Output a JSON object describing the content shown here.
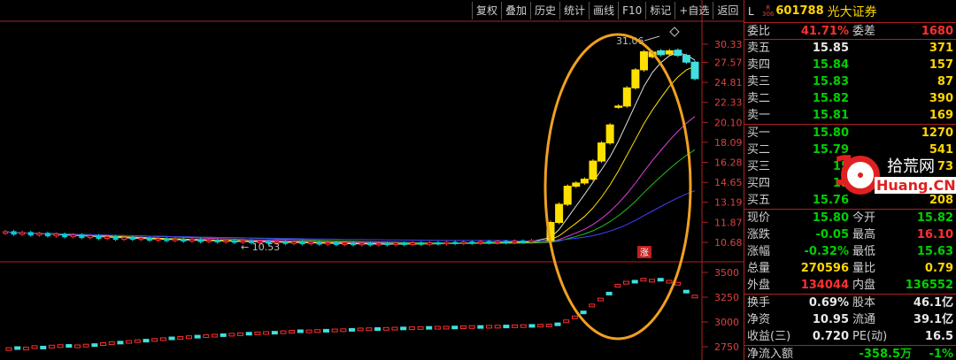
{
  "toolbar": {
    "buttons": [
      "复权",
      "叠加",
      "历史",
      "统计",
      "画线",
      "F10",
      "标记",
      "+自选",
      "返回"
    ]
  },
  "quote": {
    "market": "L",
    "market_sub": [
      "R",
      "306"
    ],
    "code": "601788",
    "name": "光大证券",
    "weibi_label": "委比",
    "weibi_value": "41.71%",
    "weicha_label": "委差",
    "weicha_value": "1680",
    "asks": [
      {
        "label": "卖五",
        "price": "15.85",
        "vol": "371"
      },
      {
        "label": "卖四",
        "price": "15.84",
        "vol": "157"
      },
      {
        "label": "卖三",
        "price": "15.83",
        "vol": "87"
      },
      {
        "label": "卖二",
        "price": "15.82",
        "vol": "390"
      },
      {
        "label": "卖一",
        "price": "15.81",
        "vol": "169"
      }
    ],
    "bids": [
      {
        "label": "买一",
        "price": "15.80",
        "vol": "1270"
      },
      {
        "label": "买二",
        "price": "15.79",
        "vol": "541"
      },
      {
        "label": "买三",
        "price": "15",
        "vol": "73"
      },
      {
        "label": "买四",
        "price": "15",
        "vol": "2"
      },
      {
        "label": "买五",
        "price": "15.76",
        "vol": "208"
      }
    ],
    "stats": [
      {
        "l1": "现价",
        "v1": "15.80",
        "c1": "green",
        "l2": "今开",
        "v2": "15.82",
        "c2": "green"
      },
      {
        "l1": "涨跌",
        "v1": "-0.05",
        "c1": "green",
        "l2": "最高",
        "v2": "16.10",
        "c2": "red"
      },
      {
        "l1": "涨幅",
        "v1": "-0.32%",
        "c1": "green",
        "l2": "最低",
        "v2": "15.63",
        "c2": "green"
      },
      {
        "l1": "总量",
        "v1": "270596",
        "c1": "yellow",
        "l2": "量比",
        "v2": "0.79",
        "c2": "yellow"
      },
      {
        "l1": "外盘",
        "v1": "134044",
        "c1": "red",
        "l2": "内盘",
        "v2": "136552",
        "c2": "green"
      }
    ],
    "fund": [
      {
        "l1": "换手",
        "v1": "0.69%",
        "l2": "股本",
        "v2": "46.1亿"
      },
      {
        "l1": "净资",
        "v1": "10.95",
        "l2": "流通",
        "v2": "39.1亿"
      },
      {
        "l1": "收益(三)",
        "v1": "0.720",
        "l2": "PE(动)",
        "v2": "16.5"
      }
    ],
    "netflow_label": "净流入额",
    "netflow_value": "-358.5万",
    "netflow_pct": "-1%"
  },
  "watermark": {
    "cn": "拾荒网",
    "en": "Huang.CN",
    "digit": "1"
  },
  "colors": {
    "up": "#ff3030",
    "down": "#00d0d0",
    "highlight": "#ffd700",
    "ring": "#f0a020"
  },
  "chart_data": {
    "type": "candlestick",
    "price_axis": [
      "30.33",
      "27.57",
      "24.81",
      "22.33",
      "20.10",
      "18.09",
      "16.28",
      "14.65",
      "13.19",
      "11.87",
      "10.68"
    ],
    "volume_axis": [
      "3500",
      "3250",
      "3000",
      "2750"
    ],
    "annotations": {
      "high": "31.06",
      "low": "10.53",
      "mark": "涨"
    },
    "candles": [
      {
        "o": 11.2,
        "c": 11.3
      },
      {
        "o": 11.3,
        "c": 11.15
      },
      {
        "o": 11.15,
        "c": 11.25
      },
      {
        "o": 11.25,
        "c": 11.1
      },
      {
        "o": 11.1,
        "c": 11.2
      },
      {
        "o": 11.2,
        "c": 11.05
      },
      {
        "o": 11.05,
        "c": 11.15
      },
      {
        "o": 11.15,
        "c": 11.0
      },
      {
        "o": 11.0,
        "c": 11.1
      },
      {
        "o": 11.1,
        "c": 10.95
      },
      {
        "o": 10.95,
        "c": 11.05
      },
      {
        "o": 11.05,
        "c": 10.9
      },
      {
        "o": 10.9,
        "c": 11.0
      },
      {
        "o": 11.0,
        "c": 10.85
      },
      {
        "o": 10.85,
        "c": 10.95
      },
      {
        "o": 10.95,
        "c": 10.85
      },
      {
        "o": 10.85,
        "c": 10.92
      },
      {
        "o": 10.92,
        "c": 10.8
      },
      {
        "o": 10.8,
        "c": 10.88
      },
      {
        "o": 10.88,
        "c": 10.78
      },
      {
        "o": 10.78,
        "c": 10.86
      },
      {
        "o": 10.86,
        "c": 10.75
      },
      {
        "o": 10.75,
        "c": 10.84
      },
      {
        "o": 10.84,
        "c": 10.72
      },
      {
        "o": 10.72,
        "c": 10.8
      },
      {
        "o": 10.8,
        "c": 10.7
      },
      {
        "o": 10.7,
        "c": 10.78
      },
      {
        "o": 10.78,
        "c": 10.68
      },
      {
        "o": 10.68,
        "c": 10.76
      },
      {
        "o": 10.76,
        "c": 10.66
      },
      {
        "o": 10.66,
        "c": 10.74
      },
      {
        "o": 10.74,
        "c": 10.64
      },
      {
        "o": 10.64,
        "c": 10.72
      },
      {
        "o": 10.72,
        "c": 10.62
      },
      {
        "o": 10.62,
        "c": 10.7
      },
      {
        "o": 10.7,
        "c": 10.6
      },
      {
        "o": 10.6,
        "c": 10.68
      },
      {
        "o": 10.68,
        "c": 10.58
      },
      {
        "o": 10.58,
        "c": 10.66
      },
      {
        "o": 10.66,
        "c": 10.56
      },
      {
        "o": 10.56,
        "c": 10.64
      },
      {
        "o": 10.64,
        "c": 10.55
      },
      {
        "o": 10.55,
        "c": 10.63
      },
      {
        "o": 10.63,
        "c": 10.54
      },
      {
        "o": 10.54,
        "c": 10.62
      },
      {
        "o": 10.62,
        "c": 10.55
      },
      {
        "o": 10.55,
        "c": 10.63
      },
      {
        "o": 10.63,
        "c": 10.56
      },
      {
        "o": 10.56,
        "c": 10.65
      },
      {
        "o": 10.65,
        "c": 10.57
      },
      {
        "o": 10.57,
        "c": 10.66
      },
      {
        "o": 10.66,
        "c": 10.6
      },
      {
        "o": 10.6,
        "c": 10.68
      },
      {
        "o": 10.68,
        "c": 10.62
      },
      {
        "o": 10.62,
        "c": 10.7
      },
      {
        "o": 10.7,
        "c": 10.64
      },
      {
        "o": 10.64,
        "c": 10.72
      },
      {
        "o": 10.72,
        "c": 10.66
      },
      {
        "o": 10.66,
        "c": 10.73
      },
      {
        "o": 10.73,
        "c": 10.67
      },
      {
        "o": 10.67,
        "c": 10.75
      },
      {
        "o": 10.75,
        "c": 10.7
      },
      {
        "o": 10.7,
        "c": 10.78
      },
      {
        "o": 10.78,
        "c": 11.86
      },
      {
        "o": 11.86,
        "c": 13.05
      },
      {
        "o": 13.05,
        "c": 14.36
      },
      {
        "o": 14.36,
        "c": 14.6
      },
      {
        "o": 14.6,
        "c": 14.9
      },
      {
        "o": 14.9,
        "c": 16.39
      },
      {
        "o": 16.39,
        "c": 18.03
      },
      {
        "o": 18.03,
        "c": 19.83
      },
      {
        "o": 21.8,
        "c": 21.9
      },
      {
        "o": 21.9,
        "c": 24.1
      },
      {
        "o": 24.1,
        "c": 26.5
      },
      {
        "o": 26.5,
        "c": 29.15
      },
      {
        "o": 28.4,
        "c": 29.1
      },
      {
        "o": 29.3,
        "c": 28.7
      },
      {
        "o": 28.8,
        "c": 29.3
      },
      {
        "o": 29.4,
        "c": 28.6
      },
      {
        "o": 28.6,
        "c": 27.6
      },
      {
        "o": 27.6,
        "c": 25.3
      }
    ],
    "volume_bars": [
      2740,
      2750,
      2745,
      2760,
      2755,
      2765,
      2770,
      2772,
      2768,
      2775,
      2780,
      2790,
      2800,
      2805,
      2812,
      2820,
      2825,
      2832,
      2840,
      2848,
      2852,
      2860,
      2865,
      2870,
      2875,
      2880,
      2885,
      2890,
      2895,
      2898,
      2902,
      2905,
      2910,
      2915,
      2920,
      2918,
      2922,
      2925,
      2928,
      2930,
      2934,
      2938,
      2940,
      2942,
      2944,
      2946,
      2948,
      2950,
      2952,
      2954,
      2955,
      2956,
      2958,
      2960,
      2962,
      2963,
      2965,
      2966,
      2968,
      2970,
      2972,
      2974,
      2976,
      2978,
      2990,
      3020,
      3060,
      3110,
      3180,
      3240,
      3300,
      3380,
      3410,
      3420,
      3440,
      3430,
      3440,
      3420,
      3400,
      3320,
      3270
    ]
  }
}
